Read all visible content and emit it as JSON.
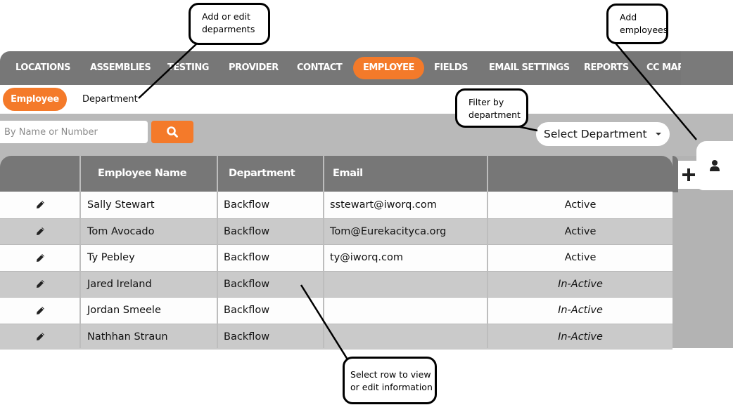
{
  "nav": {
    "items": [
      {
        "label": "LOCATIONS",
        "active": false
      },
      {
        "label": "ASSEMBLIES",
        "active": false
      },
      {
        "label": "TESTING",
        "active": false
      },
      {
        "label": "PROVIDER",
        "active": false
      },
      {
        "label": "CONTACT",
        "active": false
      },
      {
        "label": "EMPLOYEE",
        "active": true
      },
      {
        "label": "FIELDS",
        "active": false
      },
      {
        "label": "EMAIL SETTINGS",
        "active": false
      },
      {
        "label": "REPORTS",
        "active": false
      },
      {
        "label": "CC MAP",
        "active": false
      }
    ]
  },
  "subnav": {
    "employee_label": "Employee",
    "department_label": "Department"
  },
  "search": {
    "placeholder": "By Name or Number",
    "value": "",
    "button_icon": "search-icon"
  },
  "filter": {
    "selected": "Select Department"
  },
  "side": {
    "add_icon": "plus-icon",
    "user_icon": "user-icon"
  },
  "table": {
    "columns": [
      "",
      "Employee Name",
      "Department",
      "Email",
      ""
    ],
    "rows": [
      {
        "name": "Sally Stewart",
        "department": "Backflow",
        "email": "sstewart@iworq.com",
        "status": "Active"
      },
      {
        "name": "Tom Avocado",
        "department": "Backflow",
        "email": "Tom@Eurekacityca.org",
        "status": "Active"
      },
      {
        "name": "Ty Pebley",
        "department": "Backflow",
        "email": "ty@iworq.com",
        "status": "Active"
      },
      {
        "name": "Jared Ireland",
        "department": "Backflow",
        "email": "",
        "status": "In-Active"
      },
      {
        "name": "Jordan Smeele",
        "department": "Backflow",
        "email": "",
        "status": "In-Active"
      },
      {
        "name": "Nathhan Straun",
        "department": "Backflow",
        "email": "",
        "status": "In-Active"
      }
    ]
  },
  "callouts": {
    "departments": "Add or edit deparments",
    "filter": "Filter by department",
    "add_employees": "Add employees",
    "select_row": "Select row to view or edit information"
  },
  "colors": {
    "accent": "#f47a2a",
    "nav_bg": "#777777",
    "body_bg": "#b9b9b9"
  }
}
